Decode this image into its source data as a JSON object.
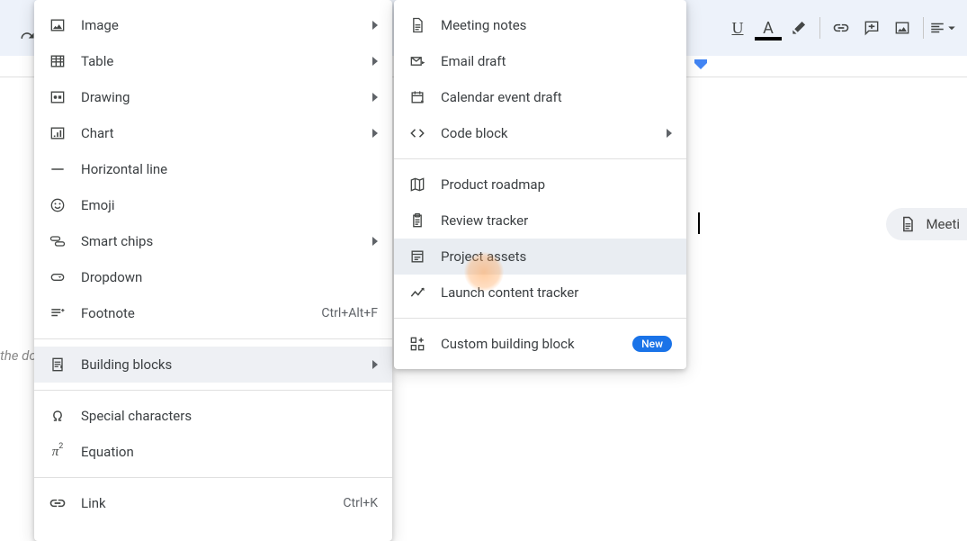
{
  "toolbar": {
    "redo": "redo",
    "underline": "U",
    "textcolor": "A"
  },
  "doc": {
    "hint_fragment": "the do",
    "side_chip": "Meeti"
  },
  "menu1": {
    "image": "Image",
    "table": "Table",
    "drawing": "Drawing",
    "chart": "Chart",
    "hline": "Horizontal line",
    "emoji": "Emoji",
    "smartchips": "Smart chips",
    "dropdown": "Dropdown",
    "footnote": "Footnote",
    "footnote_sc": "Ctrl+Alt+F",
    "building": "Building blocks",
    "special": "Special characters",
    "equation": "Equation",
    "link": "Link",
    "link_sc": "Ctrl+K"
  },
  "menu2": {
    "meeting": "Meeting notes",
    "email": "Email draft",
    "calendar": "Calendar event draft",
    "code": "Code block",
    "roadmap": "Product roadmap",
    "review": "Review tracker",
    "assets": "Project assets",
    "launch": "Launch content tracker",
    "custom": "Custom building block",
    "new_badge": "New"
  }
}
